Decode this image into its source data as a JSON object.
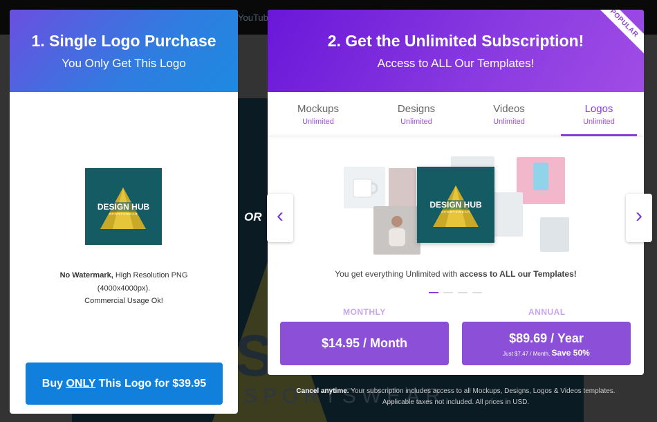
{
  "background": {
    "topbar_link": "YouTube",
    "brand_big": "S",
    "brand_text": "SPORTSWEAR"
  },
  "left_card": {
    "title": "1. Single Logo Purchase",
    "subtitle": "You Only Get This Logo",
    "logo_title": "DESIGN HUB",
    "logo_sub": "SPORTSWEAR",
    "desc_bold": "No Watermark,",
    "desc_rest": "High Resolution PNG",
    "desc_line2": "(4000x4000px).",
    "desc_line3": "Commercial Usage Ok!",
    "buy_prefix": "Buy ",
    "buy_only": "ONLY",
    "buy_suffix": " This Logo for $39.95",
    "colors": {
      "accent": "#1180dd"
    }
  },
  "or_label": "OR",
  "right_card": {
    "ribbon": "POPULAR",
    "title": "2. Get the Unlimited Subscription!",
    "subtitle": "Access to ALL Our Templates!",
    "tabs": [
      {
        "name": "Mockups",
        "sub": "Unlimited"
      },
      {
        "name": "Designs",
        "sub": "Unlimited"
      },
      {
        "name": "Videos",
        "sub": "Unlimited"
      },
      {
        "name": "Logos",
        "sub": "Unlimited"
      }
    ],
    "active_tab": "Logos",
    "prev_icon": "chevron-left-icon",
    "next_icon": "chevron-right-icon",
    "logo_title": "DESIGN HUB",
    "logo_sub": "SPORTSWEAR",
    "unlimited_prefix": "You get everything Unlimited with ",
    "unlimited_bold": "access to ALL our Templates!",
    "monthly_label": "MONTHLY",
    "annual_label": "ANNUAL",
    "monthly_price": "$14.95 / Month",
    "annual_price": "$89.69 / Year",
    "annual_note": "Just $7.47 / Month,",
    "annual_save": "Save 50%",
    "colors": {
      "accent": "#8a3be0",
      "button": "#8b4fd8"
    }
  },
  "footnote": {
    "bold": "Cancel anytime.",
    "line1": " Your subscription includes access to all Mockups, Designs, Logos & Videos templates.",
    "line2": "Applicable taxes not included. All prices in USD."
  }
}
